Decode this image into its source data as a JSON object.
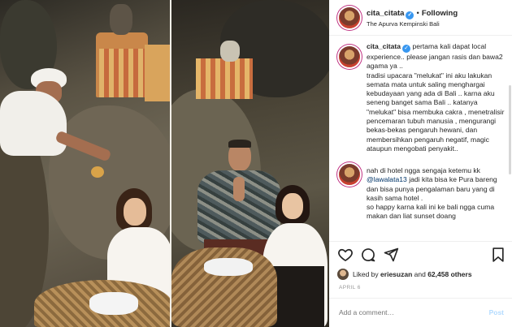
{
  "post": {
    "username": "cita_citata",
    "follow_label": "Following",
    "location": "The Apurva Kempinski Bali",
    "caption": {
      "username": "cita_citata",
      "paragraphs": [
        "pertama kali dapat local experience.. please jangan rasis dan bawa2 agama ya ..",
        "tradisi upacara \"melukat\" ini aku lakukan semata mata untuk saling menghargai kebudayaan yang ada di Bali .. karna aku seneng banget sama Bali .. katanya \"melukat\" bisa membuka cakra ,  menetralisir pencemaran tubuh manusia ,  mengurangi bekas-bekas pengaruh hewani,  dan membersihkan pengaruh negatif, magic ataupun mengobati penyakit.."
      ],
      "paragraph2_start": "nah di hotel ngga sengaja ketemu kk",
      "mention": "@lawalata13",
      "paragraph2_rest": "jadi kita bisa ke Pura bareng dan bisa punya pengalaman baru yang di kasih sama hotel .",
      "paragraph3": "so happy karna kali ini ke bali ngga cuma makan dan liat sunset doang"
    },
    "likes": {
      "prefix": "Liked by",
      "user": "eriesuzan",
      "connector": "and",
      "count": "62,458 others"
    },
    "date": "APRIL 6",
    "add_comment_placeholder": "Add a comment…",
    "post_label": "Post"
  },
  "icons": {
    "verified": "verified-badge-icon",
    "like": "heart-icon",
    "comment": "comment-bubble-icon",
    "share": "paper-plane-icon",
    "save": "bookmark-icon"
  },
  "colors": {
    "accent": "#3897f0",
    "post_disabled": "#b3dbff",
    "mention": "#003569"
  }
}
